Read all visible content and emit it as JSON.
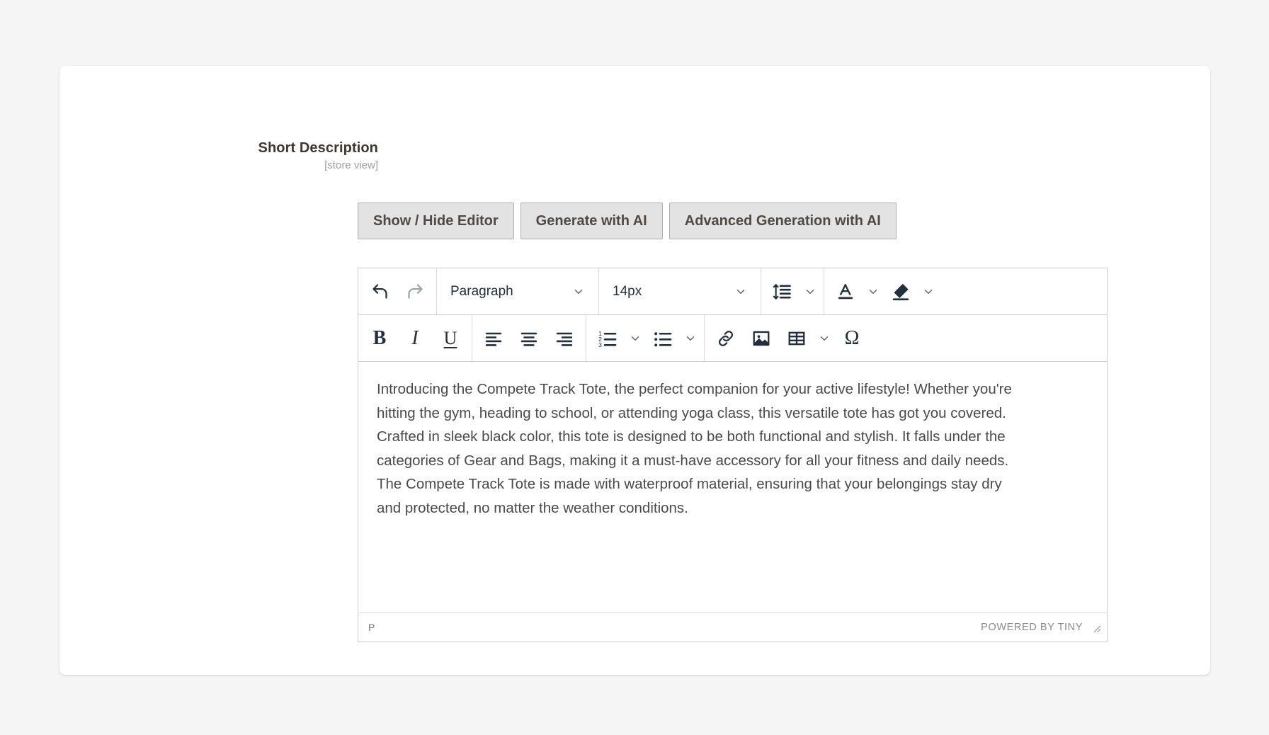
{
  "field": {
    "label": "Short Description",
    "scope": "[store view]"
  },
  "buttons": [
    {
      "id": "show-hide-editor",
      "label": "Show / Hide Editor"
    },
    {
      "id": "generate-with-ai",
      "label": "Generate with AI"
    },
    {
      "id": "advanced-generation-with-ai",
      "label": "Advanced Generation with AI"
    }
  ],
  "editor": {
    "toolbar_row1": {
      "undo": "undo-icon",
      "redo": "redo-icon",
      "block_format": "Paragraph",
      "font_size": "14px",
      "line_height": "line-height-icon",
      "text_color": "text-color-icon",
      "background_color": "highlight-color-icon"
    },
    "toolbar_row2": {
      "bold": "B",
      "italic": "I",
      "underline": "U",
      "align_left": "align-left-icon",
      "align_center": "align-center-icon",
      "align_right": "align-right-icon",
      "numbered_list": "numbered-list-icon",
      "bullet_list": "bullet-list-icon",
      "link": "link-icon",
      "image": "image-icon",
      "table": "table-icon",
      "special_character": "Ω"
    },
    "content": "Introducing the Compete Track Tote, the perfect companion for your active lifestyle! Whether you're hitting the gym, heading to school, or attending yoga class, this versatile tote has got you covered. Crafted in sleek black color, this tote is designed to be both functional and stylish. It falls under the categories of Gear and Bags, making it a must-have accessory for all your fitness and daily needs. The Compete Track Tote is made with waterproof material, ensuring that your belongings stay dry and protected, no matter the weather conditions.",
    "status": {
      "element_path": "P",
      "branding": "POWERED BY TINY"
    }
  },
  "colors": {
    "page_background": "#f5f5f5",
    "card_background": "#ffffff",
    "button_face": "#e3e3e3",
    "button_border": "#adadad",
    "label_text": "#41362f",
    "scope_text": "#9e9e9e",
    "body_text": "#4a4a4a",
    "toolbar_icon": "#222f3e"
  }
}
